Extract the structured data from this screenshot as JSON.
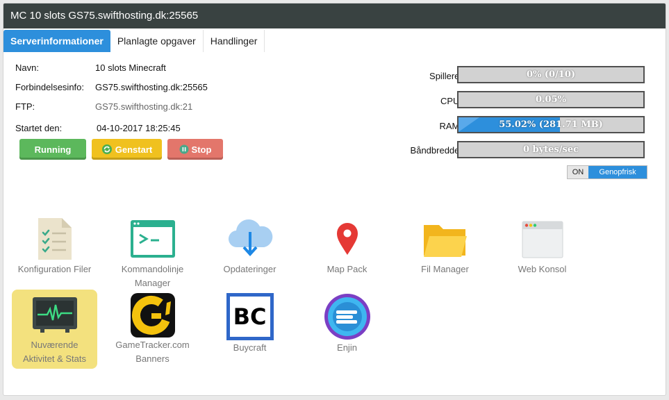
{
  "window": {
    "title": "MC 10 slots GS75.swifthosting.dk:25565"
  },
  "tabs": [
    "Serverinformationer",
    "Planlagte opgaver",
    "Handlinger"
  ],
  "info": {
    "name_label": "Navn:",
    "name_value": "10 slots Minecraft",
    "conn_label": "Forbindelsesinfo:",
    "conn_value": "GS75.swifthosting.dk:25565",
    "ftp_label": "FTP:",
    "ftp_value": "GS75.swifthosting.dk:21",
    "started_label": "Startet den:",
    "started_value": "04-10-2017 18:25:45"
  },
  "buttons": {
    "running": "Running",
    "restart": "Genstart",
    "stop": "Stop"
  },
  "stats": {
    "players": {
      "label": "Spillere:",
      "text": "0% (0/10)",
      "percent": 0
    },
    "cpu": {
      "label": "CPU:",
      "text": "0.05%",
      "percent": 0.05
    },
    "ram": {
      "label": "RAM:",
      "text": "55.02% (281.71 MB)",
      "percent": 55.02
    },
    "bandwidth": {
      "label": "Båndbredde:",
      "text": "0 bytes/sec",
      "percent": 0
    }
  },
  "refresh": {
    "state": "ON",
    "label": "Genopfrisk"
  },
  "tiles": {
    "config": {
      "line1": "Konfiguration Filer",
      "line2": ""
    },
    "console": {
      "line1": "Kommandolinje",
      "line2": "Manager"
    },
    "updates": {
      "line1": "Opdateringer",
      "line2": ""
    },
    "mappack": {
      "line1": "Map Pack",
      "line2": ""
    },
    "filemanager": {
      "line1": "Fil Manager",
      "line2": ""
    },
    "webconsole": {
      "line1": "Web Konsol",
      "line2": ""
    },
    "activity": {
      "line1": "Nuværende",
      "line2": "Aktivitet & Stats"
    },
    "gametracker": {
      "line1": "GameTracker.com",
      "line2": "Banners"
    },
    "buycraft": {
      "line1": "Buycraft",
      "line2": "",
      "logo": "BC"
    },
    "enjin": {
      "line1": "Enjin",
      "line2": ""
    }
  },
  "colors": {
    "accent": "#2d8fdc",
    "running": "#5cb85c",
    "restart": "#f0c11f",
    "stop": "#e3766b",
    "titlebar": "#394241",
    "highlight": "#f3e17e"
  }
}
